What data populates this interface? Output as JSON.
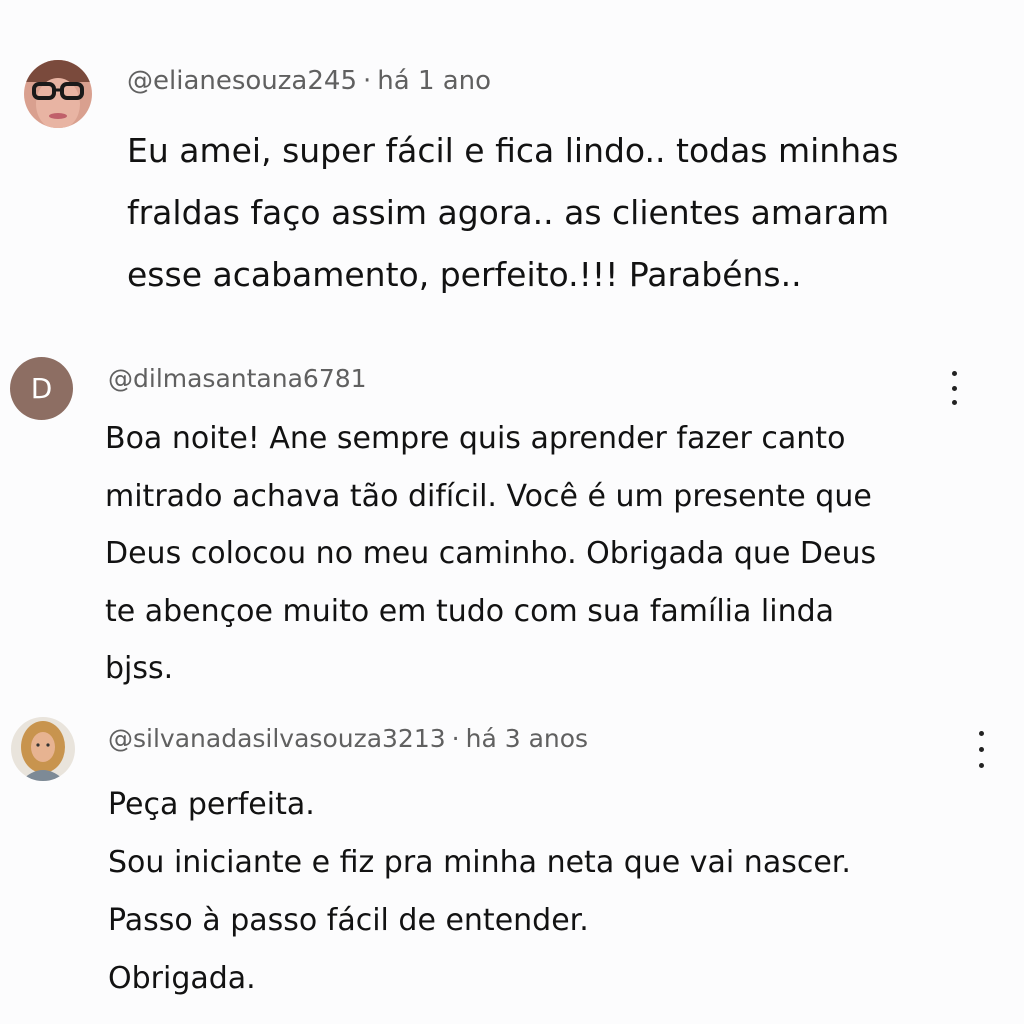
{
  "comments": [
    {
      "username": "@elianesouza245",
      "separator": "·",
      "time": "há 1 ano",
      "lines": [
        "Eu amei, super fácil e fica lindo.. todas minhas",
        "fraldas faço  assim agora.. as clientes amaram",
        "esse acabamento, perfeito.!!! Parabéns.."
      ],
      "avatar_icon": "user-photo-avatar"
    },
    {
      "username": "@dilmasantana6781",
      "avatar_letter": "D",
      "avatar_color": "#8d6e63",
      "lines": [
        "Boa noite! Ane sempre quis aprender fazer canto",
        "mitrado achava tão difícil. Você é um presente que",
        "Deus colocou no meu caminho. Obrigada que Deus",
        "te abençoe muito em tudo com sua família linda",
        "bjss."
      ],
      "menu_icon": "more-vertical-icon"
    },
    {
      "username": "@silvanadasilvasouza3213",
      "separator": "·",
      "time": "há 3 anos",
      "lines": [
        "Peça perfeita.",
        "Sou iniciante e fiz pra minha neta que vai nascer.",
        "Passo à passo fácil de entender.",
        "Obrigada."
      ],
      "avatar_icon": "user-photo-avatar",
      "menu_icon": "more-vertical-icon"
    }
  ]
}
